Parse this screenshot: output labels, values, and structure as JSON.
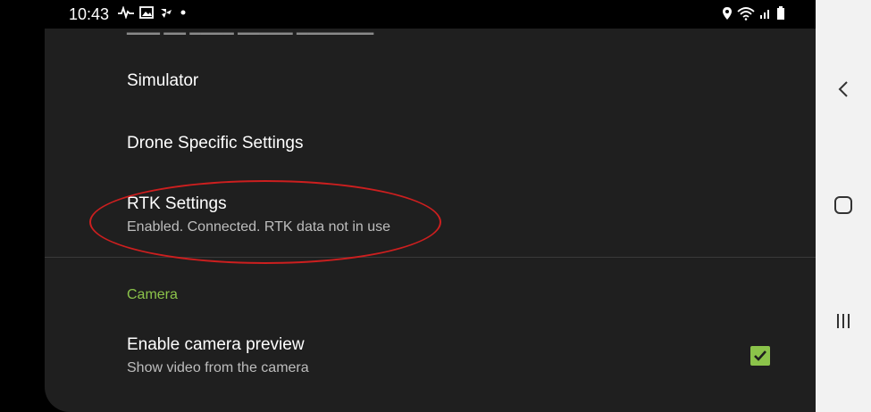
{
  "status_bar": {
    "time": "10:43",
    "left_icons": [
      "activity-icon",
      "image-icon",
      "fan-icon",
      "dot-icon"
    ],
    "right_icons": [
      "location-icon",
      "wifi-icon",
      "signal-icon",
      "battery-icon"
    ]
  },
  "settings": {
    "items": [
      {
        "title": "Simulator",
        "summary": ""
      },
      {
        "title": "Drone Specific Settings",
        "summary": ""
      },
      {
        "title": "RTK Settings",
        "summary": "Enabled. Connected. RTK data not in use"
      }
    ],
    "category": "Camera",
    "camera_preview": {
      "title": "Enable camera preview",
      "summary": "Show video from the camera",
      "checked": true
    }
  },
  "colors": {
    "accent": "#8bc34a",
    "panel_bg": "#1f1f1f",
    "annotation": "#cc1f1f",
    "nav_bg": "#f2f2f2"
  },
  "nav_bar": {
    "buttons": [
      "back-icon",
      "home-icon",
      "recents-icon"
    ]
  }
}
